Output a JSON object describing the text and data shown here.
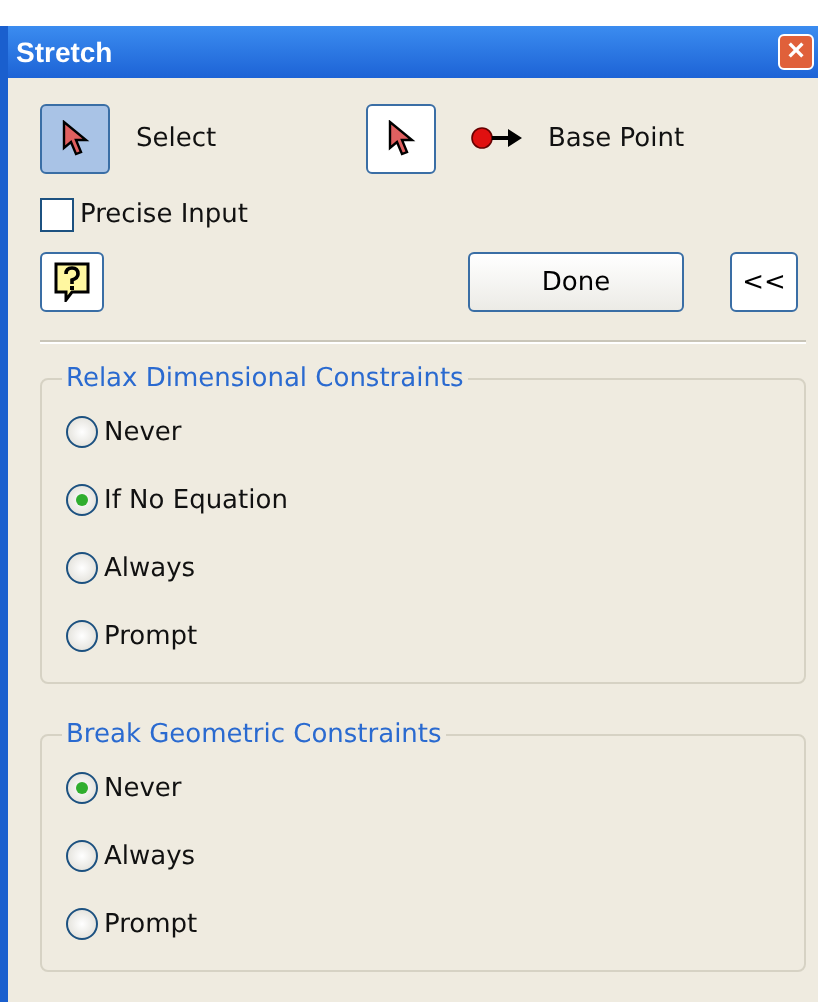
{
  "window": {
    "title": "Stretch",
    "close": "×"
  },
  "select": {
    "label": "Select",
    "pressed": true
  },
  "base_point": {
    "label": "Base Point",
    "pressed": false
  },
  "precise_input": {
    "label": "Precise Input",
    "checked": false
  },
  "buttons": {
    "done": "Done",
    "collapse": "<<"
  },
  "groups": [
    {
      "title": "Relax Dimensional Constraints",
      "options": [
        {
          "label": "Never",
          "selected": false
        },
        {
          "label": "If No Equation",
          "selected": true
        },
        {
          "label": "Always",
          "selected": false
        },
        {
          "label": "Prompt",
          "selected": false
        }
      ]
    },
    {
      "title": "Break Geometric Constraints",
      "options": [
        {
          "label": "Never",
          "selected": true
        },
        {
          "label": "Always",
          "selected": false
        },
        {
          "label": "Prompt",
          "selected": false
        }
      ]
    }
  ]
}
